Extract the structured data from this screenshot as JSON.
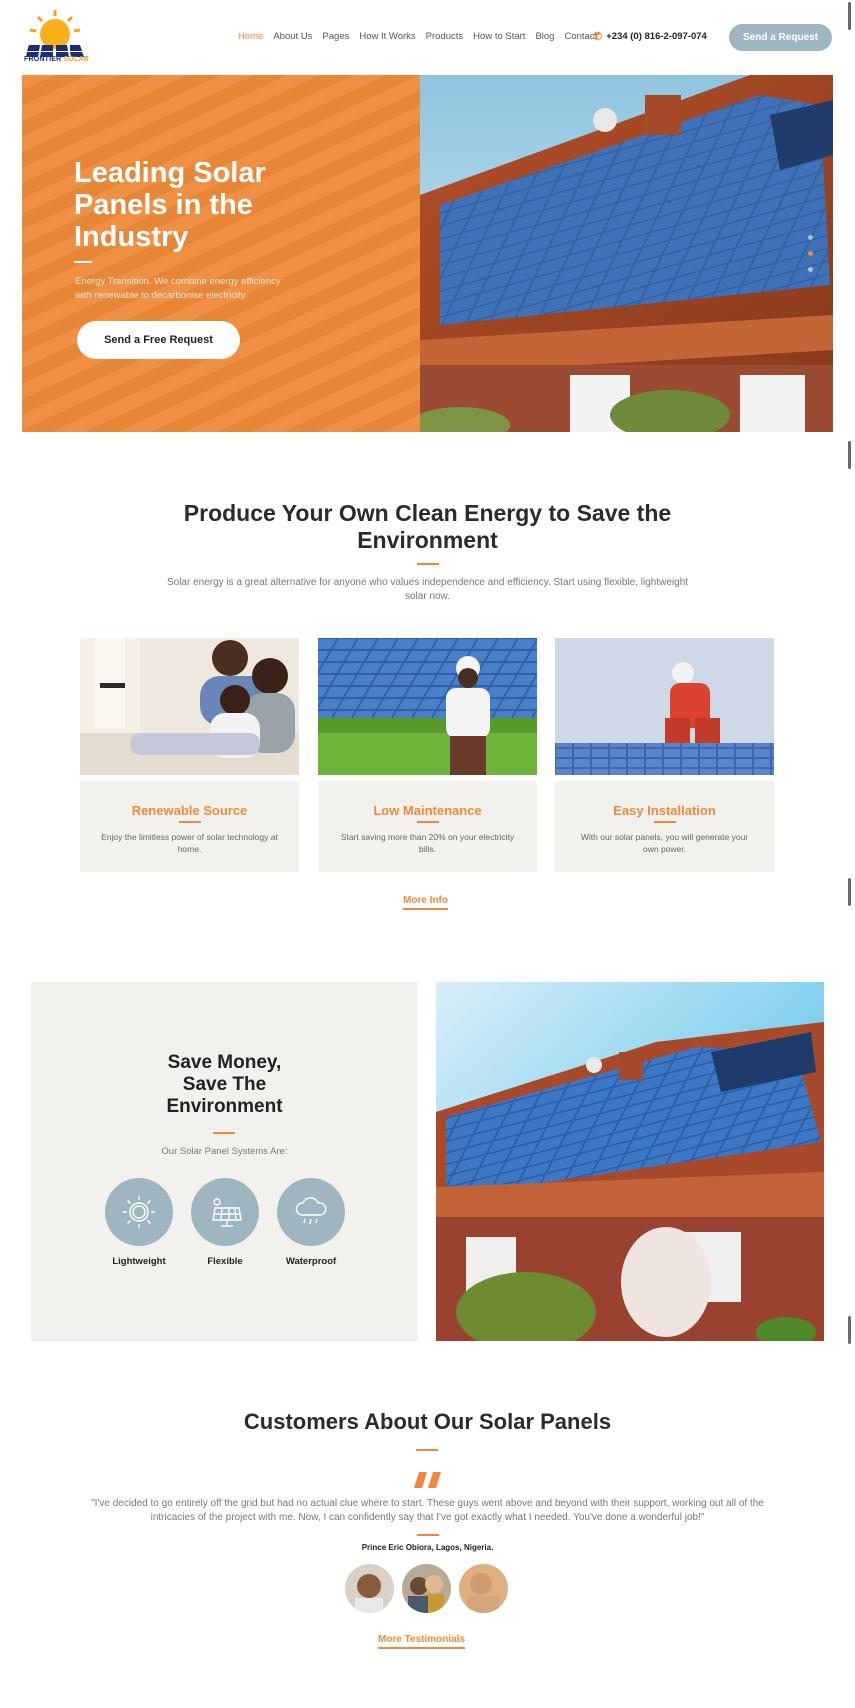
{
  "brand": {
    "name_part1": "FRONTIER",
    "name_part2": "SOLAR"
  },
  "nav": {
    "items": [
      "Home",
      "About Us",
      "Pages",
      "How It Works",
      "Products",
      "How to Start",
      "Blog",
      "Contact"
    ],
    "active": "Home",
    "phone": "+234 (0) 816-2-097-074",
    "cta": "Send a Request"
  },
  "hero": {
    "title": "Leading Solar Panels in the Industry",
    "text": "Energy Transition. We combine energy efficiency with renewable to decarbonise electricity.",
    "button": "Send a Free Request",
    "slides": 3,
    "active_slide": 2
  },
  "produce": {
    "title": "Produce Your Own Clean Energy to Save the Environment",
    "text": "Solar energy is a great alternative for anyone who values independence and efficiency. Start using flexible, lightweight solar now.",
    "cards": [
      {
        "title": "Renewable Source",
        "text": "Enjoy the limitless power of solar technology at home."
      },
      {
        "title": "Low Maintenance",
        "text": "Start saving more than 20% on your electricity bills."
      },
      {
        "title": "Easy Installation",
        "text": "With our solar panels, you will generate your own power."
      }
    ],
    "more": "More Info"
  },
  "save": {
    "title": "Save Money, Save The Environment",
    "subtitle": "Our Solar Panel Systems Are:",
    "features": [
      {
        "label": "Lightweight",
        "icon": "sun-icon"
      },
      {
        "label": "Flexible",
        "icon": "solar-panel-icon"
      },
      {
        "label": "Waterproof",
        "icon": "cloud-rain-icon"
      }
    ]
  },
  "testimonials": {
    "title": "Customers About Our Solar Panels",
    "quote": "\"I've decided to go entirely off the grid but had no actual clue where to start. These guys went above and beyond with their support, working out all of the intricacies of the project with me. Now, I can confidently say that I've got exactly what I needed. You've done a wonderful job!\"",
    "author": "Prince Eric Obiora, Lagos, Nigeria.",
    "more": "More Testimonials"
  },
  "colors": {
    "accent": "#ef8a3a",
    "muted_blue": "#9fb6c1",
    "panel_bg": "#f2f1ed"
  }
}
